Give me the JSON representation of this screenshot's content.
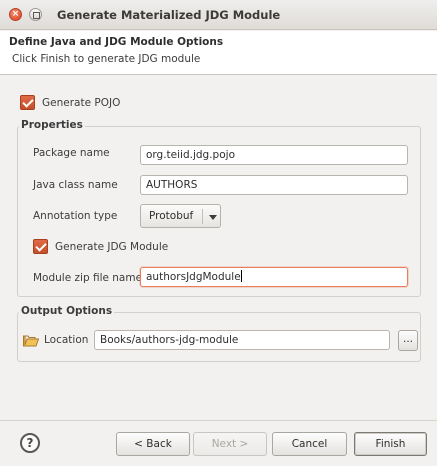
{
  "window": {
    "title": "Generate Materialized JDG Module",
    "close_glyph": "×"
  },
  "header": {
    "title": "Define Java and JDG Module Options",
    "message": "Click Finish to generate JDG module"
  },
  "options": {
    "generate_pojo": {
      "label": "Generate POJO",
      "checked": true
    }
  },
  "properties": {
    "title": "Properties",
    "package_name": {
      "label": "Package name",
      "value": "org.teiid.jdg.pojo"
    },
    "java_class_name": {
      "label": "Java class name",
      "value": "AUTHORS"
    },
    "annotation_type": {
      "label": "Annotation type",
      "value": "Protobuf"
    },
    "generate_jdg_module": {
      "label": "Generate JDG Module",
      "checked": true
    },
    "module_zip_file_name": {
      "label": "Module zip file name",
      "value": "authorsJdgModule"
    }
  },
  "output_options": {
    "title": "Output Options",
    "location_label": "Location",
    "location_value": "Books/authors-jdg-module",
    "browse_label": "..."
  },
  "buttons": {
    "help": "?",
    "back": "< Back",
    "next": "Next >",
    "cancel": "Cancel",
    "finish": "Finish"
  },
  "colors": {
    "accent": "#d85a32",
    "focus_border": "#e87e5b",
    "dialog_bg": "#f2f1f0"
  },
  "icons": {
    "folder": "folder-open-icon",
    "help": "help-icon",
    "dropdown": "chevron-down-icon"
  }
}
